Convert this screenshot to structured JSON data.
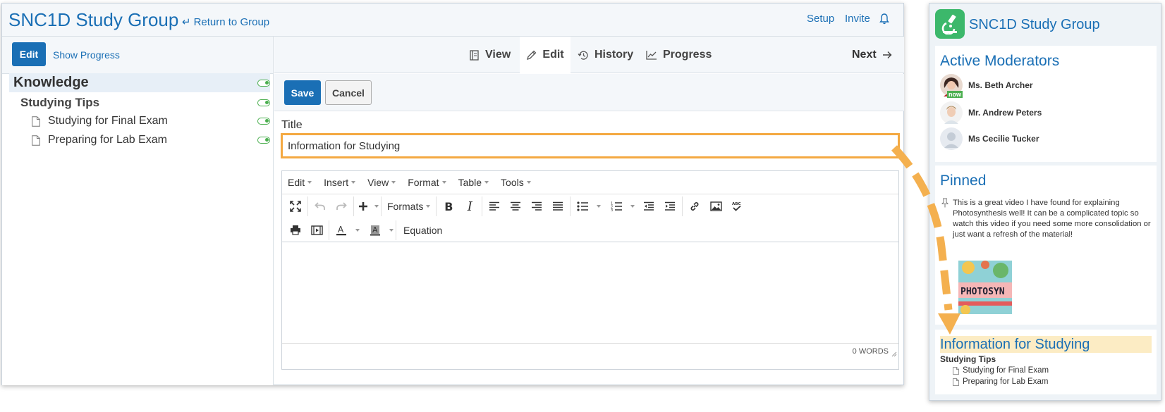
{
  "app": {
    "title": "SNC1D Study Group",
    "return_link": "Return to Group",
    "setup": "Setup",
    "invite": "Invite"
  },
  "left": {
    "edit_button": "Edit",
    "show_progress": "Show Progress",
    "tree": {
      "root": "Knowledge",
      "section": "Studying Tips",
      "items": [
        "Studying for Final Exam",
        "Preparing for Lab Exam"
      ]
    }
  },
  "tabs": {
    "view": "View",
    "edit": "Edit",
    "history": "History",
    "progress": "Progress",
    "next": "Next"
  },
  "actions": {
    "save": "Save",
    "cancel": "Cancel"
  },
  "form": {
    "title_label": "Title",
    "title_value": "Information for Studying"
  },
  "editor": {
    "menus": [
      "Edit",
      "Insert",
      "View",
      "Format",
      "Table",
      "Tools"
    ],
    "formats_label": "Formats",
    "equation_label": "Equation",
    "word_count": "0 WORDS"
  },
  "sidebar": {
    "title": "SNC1D Study Group",
    "moderators_heading": "Active Moderators",
    "moderators": [
      {
        "name": "Ms. Beth Archer",
        "status": "now"
      },
      {
        "name": "Mr. Andrew Peters"
      },
      {
        "name": "Ms Cecilie Tucker"
      }
    ],
    "pinned_heading": "Pinned",
    "pinned_text": "This is a great video I have found for explaining Photosynthesis well! It can be a complicated topic so watch this video if you need some more consolidation or just want a refresh of the material!",
    "pinned_thumb_text": "PHOTOSYN",
    "info_heading": "Information for Studying",
    "info_section": "Studying Tips",
    "info_items": [
      "Studying for Final Exam",
      "Preparing for Lab Exam"
    ]
  },
  "colors": {
    "accent": "#1a6fb5",
    "highlight_border": "#f4a942",
    "toggle_on": "#4caf50",
    "logo_bg": "#3cb86b"
  }
}
